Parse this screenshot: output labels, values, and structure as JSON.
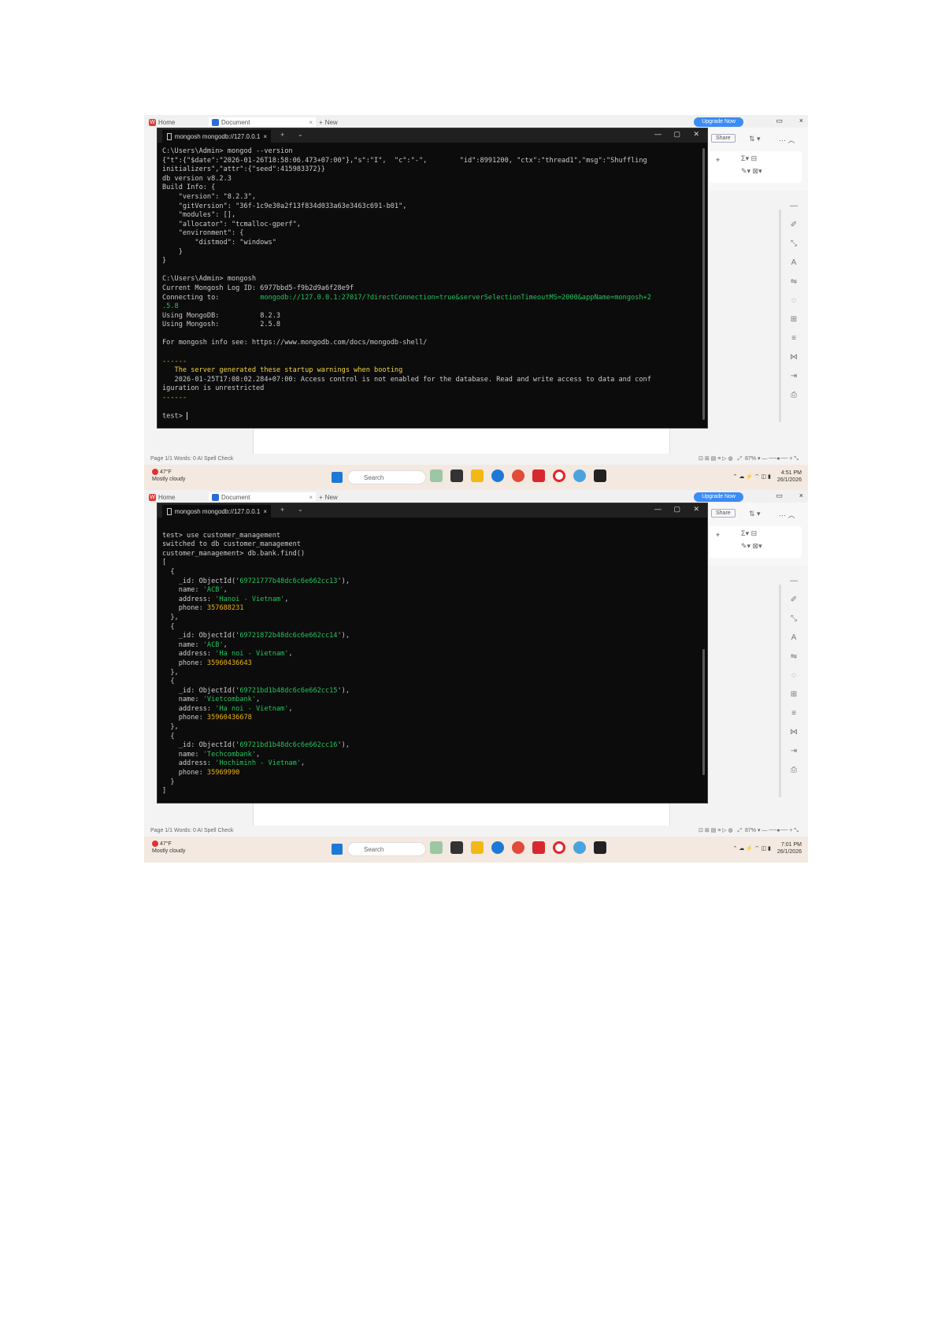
{
  "screens": [
    {
      "host": {
        "tab_wps": "Home",
        "tab_doc": "Document",
        "tab_new": "New",
        "upgrade": "Upgrade Now",
        "share": "Share"
      },
      "terminal": {
        "tab_title": "mongosh mongodb://127.0.0.1"
      },
      "status": {
        "left": "Page 1/1   Words: 0   AI Spell Check",
        "zoom": "87%"
      },
      "taskbar": {
        "weather_temp": "47°F",
        "weather_desc": "Mostly cloudy",
        "search": "Search",
        "time": "4:51 PM",
        "date": "26/1/2026"
      }
    },
    {
      "host": {
        "tab_wps": "Home",
        "tab_doc": "Document",
        "tab_new": "New",
        "upgrade": "Upgrade Now",
        "share": "Share"
      },
      "terminal": {
        "tab_title": "mongosh mongodb://127.0.0.1"
      },
      "status": {
        "left": "Page 1/1   Words: 0   AI Spell Check",
        "zoom": "87%"
      },
      "taskbar": {
        "weather_temp": "47°F",
        "weather_desc": "Mostly cloudy",
        "search": "Search",
        "time": "7:01 PM",
        "date": "26/1/2026"
      }
    }
  ],
  "term1": {
    "l1": "C:\\Users\\Admin> mongod --version",
    "l2": "{\"t\":{\"$date\":\"2026-01-26T18:58:06.473+07:00\"},\"s\":\"I\",  \"c\":\"-\",        \"id\":8991200, \"ctx\":\"thread1\",\"msg\":\"Shuffling",
    "l3": "initializers\",\"attr\":{\"seed\":415983372}}",
    "l4": "db version v8.2.3",
    "l5": "Build Info: {",
    "l6": "    \"version\": \"8.2.3\",",
    "l7": "    \"gitVersion\": \"36f-1c9e30a2f13f834d033a63e3463c691-b01\",",
    "l8": "    \"modules\": [],",
    "l9": "    \"allocator\": \"tcmalloc-gperf\",",
    "l10": "    \"environment\": {",
    "l11": "        \"distmod\": \"windows\"",
    "l12": "    }",
    "l13": "}",
    "l14": "C:\\Users\\Admin> mongosh",
    "l15": "Current Mongosh Log ID: 6977bbd5-f9b2d9a6f28e9f",
    "l16a": "Connecting to:          ",
    "l16b": "mongodb://127.0.0.1:27017/?directConnection=true&serverSelectionTimeoutMS=2000&appName=mongosh+2",
    "l17": ".5.8",
    "l18a": "Using MongoDB:          ",
    "l18b": "8.2.3",
    "l19a": "Using Mongosh:          ",
    "l19b": "2.5.8",
    "l20": "For mongosh info see: https://www.mongodb.com/docs/mongodb-shell/",
    "l21": "------",
    "l22": "   The server generated these startup warnings when booting",
    "l23": "   2026-01-25T17:08:02.284+07:00: Access control is not enabled for the database. Read and write access to data and conf",
    "l24": "iguration is unrestricted",
    "l25": "------",
    "prompt": "test> "
  },
  "term2": {
    "l1": "test> use customer_management",
    "l2": "switched to db customer_management",
    "l3": "customer_management> db.bank.find()",
    "open": "[",
    "records": [
      {
        "id": "69721777b48dc6c6e662cc13",
        "name": "'ACB'",
        "address": "'Hanoi - Vietnam'",
        "phone": "357688231"
      },
      {
        "id": "69721872b48dc6c6e662cc14",
        "name": "'ACB'",
        "address": "'Ha noi - Vietnam'",
        "phone": "35960436643"
      },
      {
        "id": "69721bd1b48dc6c6e662cc15",
        "name": "'Vietcombank'",
        "address": "'Ha noi - Vietnam'",
        "phone": "35960436678"
      },
      {
        "id": "69721bd1b48dc6c6e662cc16",
        "name": "'Techcombank'",
        "address": "'Hochiminh - Vietnam'",
        "phone": "35969990"
      }
    ],
    "close": "]"
  },
  "colors": {
    "terminal_bg": "#0c0c0c",
    "green": "#22c55e",
    "yellow": "#eab308",
    "taskbar": "#f3e9e0"
  },
  "icons": [
    "terminal-icon",
    "windows-start-icon",
    "search-icon",
    "file-explorer-icon",
    "edge-icon",
    "chrome-icon",
    "opera-icon",
    "wps-icon"
  ]
}
